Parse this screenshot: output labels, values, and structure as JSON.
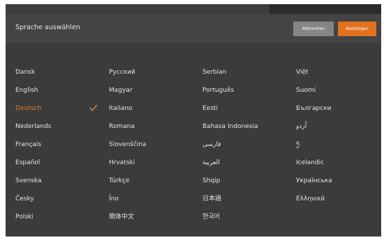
{
  "dialog": {
    "title": "Sprache auswählen",
    "cancel_label": "Abbrechen",
    "confirm_label": "Bestätigen",
    "accent_color": "#e3721c"
  },
  "languages": {
    "col1": [
      "Dansk",
      "English",
      "Deutsch",
      "Nederlands",
      "Français",
      "Español",
      "Svenska",
      "Česky",
      "Polski"
    ],
    "col2": [
      "Русский",
      "Magyar",
      "Italiano",
      "Romana",
      "Slovenščina",
      "Hrvatski",
      "Türkçe",
      "Ĩno",
      "簡体中文"
    ],
    "col3": [
      "Serbian",
      "Português",
      "Eesti",
      "Bahasa Indonesia",
      "فارسی",
      "العربية",
      "Shqip",
      "日本語",
      "한국어"
    ],
    "col4": [
      "Việt",
      "Suomi",
      "Български",
      "اُردو",
      "ཏྲ",
      "Icelandic",
      "Українська",
      "Ελληνικά"
    ]
  },
  "selected_language": "Deutsch",
  "selected_icon": "checkmark-icon"
}
